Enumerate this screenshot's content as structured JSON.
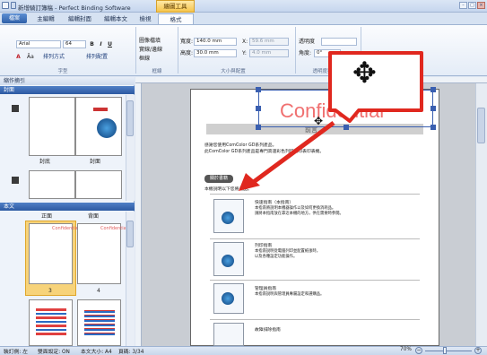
{
  "app": {
    "title": "新增騎訂簿稿 - Perfect Binding Software",
    "context_tab_group": "繪圖工具"
  },
  "tabs": [
    {
      "label": "主編輯"
    },
    {
      "label": "編輯封面"
    },
    {
      "label": "編輯本文"
    },
    {
      "label": "檢視"
    },
    {
      "label": "格式"
    }
  ],
  "file_button": "檔案",
  "ribbon": {
    "font_name": "Arial",
    "font_size": "64",
    "bold": "B",
    "italic": "I",
    "underline": "U",
    "font_color": "A",
    "char_spacing": "Āa",
    "line_spacing": "排列方式",
    "arrange": "排列配置",
    "shape_fill": "圖像檔填",
    "shape_outline": "實線/邊線",
    "line_style": "框線",
    "width_label": "寬度:",
    "width_value": "140.0 mm",
    "height_label": "高度:",
    "height_value": "30.0 mm",
    "x_label": "X:",
    "x_value": "59.6 mm",
    "y_label": "Y:",
    "y_value": "4.0 mm",
    "opacity_label": "透明度",
    "opacity_value": "",
    "angle_label": "角度:",
    "angle_value": "0°",
    "groups": [
      "字型",
      "框線",
      "大小與配置",
      "透明度與角度"
    ]
  },
  "left_panel": {
    "title": "縮作摘引",
    "cover_section": "封面",
    "cover_labels": [
      "封底",
      "封面"
    ],
    "body_section": "本文",
    "body_labels": [
      "正面",
      "背面"
    ],
    "page_numbers": [
      "3",
      "4"
    ],
    "watermark_text": "Confidential"
  },
  "document": {
    "watermark": "Confidential",
    "header_bar": "前言",
    "intro_line1": "感謝您使用ComColor GD系列產品。",
    "intro_line2": "此ComColor GD系列產品是專門高速彩色列印的印表印表機。",
    "section_heading": "關於書籍",
    "section_intro": "本機說明以下您將產品。",
    "entries": [
      {
        "title": "快速指南（本指南）",
        "line1": "本指南將說明本機器操作以及如何更換消耗品。",
        "line2": "請將本指南放在靠近本機的地方，供在需要時參閱。"
      },
      {
        "title": "列印指南",
        "line1": "本指南說明從電腦列印並配置紙張時，",
        "line2": "以及各種設定功能操作。"
      },
      {
        "title": "管理員指南",
        "line1": "本指南說明與管理員專屬設定和選購品。",
        "line2": ""
      },
      {
        "title": "故障排除指南",
        "line1": "",
        "line2": ""
      }
    ]
  },
  "callout": {
    "icon": "move-icon"
  },
  "statusbar": {
    "binding": "裝訂側: 左",
    "duplex": "雙面設定: ON",
    "paper": "本文大小: A4",
    "pages": "頁碼: 3/34",
    "zoom": "70%"
  }
}
